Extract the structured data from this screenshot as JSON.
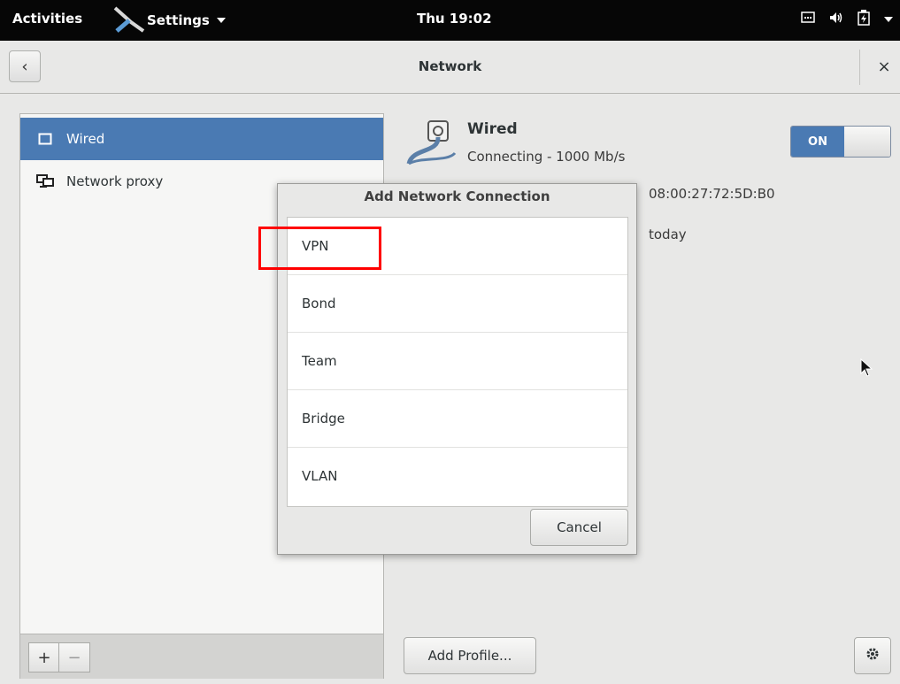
{
  "topbar": {
    "activities": "Activities",
    "app_menu": "Settings",
    "clock": "Thu 19:02",
    "tray_icons": [
      "network-icon",
      "volume-icon",
      "battery-icon",
      "menu-arrow-icon"
    ]
  },
  "headerbar": {
    "title": "Network"
  },
  "sidebar": {
    "items": [
      {
        "label": "Wired",
        "icon": "network-wired-icon",
        "selected": true
      },
      {
        "label": "Network proxy",
        "icon": "network-proxy-icon",
        "selected": false
      }
    ],
    "add_label": "+",
    "remove_label": "−"
  },
  "device": {
    "title": "Wired",
    "status": "Connecting - 1000 Mb/s",
    "switch_label": "ON",
    "hardware_address": "08:00:27:72:5D:B0",
    "last_used": "today"
  },
  "actions": {
    "add_profile": "Add Profile..."
  },
  "dialog": {
    "title": "Add Network Connection",
    "options": [
      "VPN",
      "Bond",
      "Team",
      "Bridge",
      "VLAN"
    ],
    "cancel": "Cancel"
  },
  "colors": {
    "accent": "#4a7ab3",
    "topbar": "#060606",
    "highlight": "#ff0000"
  }
}
